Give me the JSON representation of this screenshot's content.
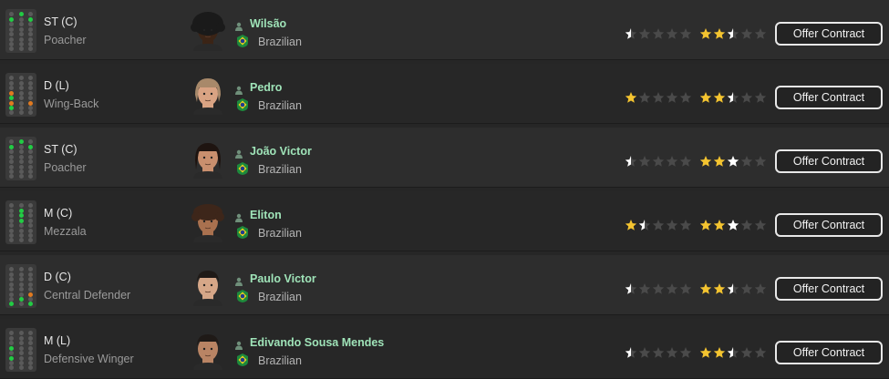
{
  "colors": {
    "name_text": "#9fe3b8",
    "star_gold": "#f4c430",
    "star_white": "#ffffff",
    "star_empty": "#4a4a4a",
    "dot_green": "#22cc44",
    "dot_orange": "#e07a20",
    "dot_yellow": "#d7c83a"
  },
  "players": [
    {
      "position": "ST (C)",
      "role": "Poacher",
      "name": "Wilsão",
      "nationality": "Brazilian",
      "action_label": "Offer Contract",
      "current_ability_stars": 0.5,
      "potential_ability_stars": 2.5,
      "potential_extra": "gold",
      "pitch_marks": [
        [
          "green",
          "top-center"
        ],
        [
          "green",
          "top-left"
        ],
        [
          "green",
          "top-right"
        ]
      ],
      "hair": "afro",
      "skin": "#3b2416"
    },
    {
      "position": "D (L)",
      "role": "Wing-Back",
      "name": "Pedro",
      "nationality": "Brazilian",
      "action_label": "Offer Contract",
      "current_ability_stars": 1,
      "potential_ability_stars": 2.5,
      "potential_extra": "gold",
      "pitch_marks": [
        [
          "orange",
          "left-mid"
        ],
        [
          "green",
          "left-low"
        ],
        [
          "orange",
          "left-mid2"
        ],
        [
          "orange",
          "right-low"
        ],
        [
          "green",
          "left-back"
        ]
      ],
      "hair": "long-light",
      "skin": "#d9a383"
    },
    {
      "position": "ST (C)",
      "role": "Poacher",
      "name": "João Victor",
      "nationality": "Brazilian",
      "action_label": "Offer Contract",
      "current_ability_stars": 0.5,
      "potential_ability_stars": 3,
      "potential_extra": "white",
      "pitch_marks": [
        [
          "green",
          "top-center"
        ],
        [
          "green",
          "top-left"
        ],
        [
          "green",
          "top-right"
        ]
      ],
      "hair": "long-dark",
      "skin": "#c98f6e"
    },
    {
      "position": "M (C)",
      "role": "Mezzala",
      "name": "Eliton",
      "nationality": "Brazilian",
      "action_label": "Offer Contract",
      "current_ability_stars": 1.5,
      "potential_ability_stars": 3,
      "potential_extra": "white",
      "pitch_marks": [
        [
          "green",
          "mid-center"
        ],
        [
          "green",
          "mid-center2"
        ],
        [
          "green",
          "mid-center3"
        ]
      ],
      "hair": "curly",
      "skin": "#a9714f"
    },
    {
      "position": "D (C)",
      "role": "Central Defender",
      "name": "Paulo Victor",
      "nationality": "Brazilian",
      "action_label": "Offer Contract",
      "current_ability_stars": 0.5,
      "potential_ability_stars": 2.5,
      "potential_extra": "gold",
      "pitch_marks": [
        [
          "orange",
          "right-low"
        ],
        [
          "green",
          "back-center"
        ],
        [
          "green",
          "back-left"
        ],
        [
          "green",
          "back-right"
        ]
      ],
      "hair": "short-dark",
      "skin": "#d6a788"
    },
    {
      "position": "M (L)",
      "role": "Defensive Winger",
      "name": "Edivando Sousa Mendes",
      "nationality": "Brazilian",
      "action_label": "Offer Contract",
      "current_ability_stars": 0.5,
      "potential_ability_stars": 2.5,
      "potential_extra": "gold",
      "pitch_marks": [
        [
          "yellow",
          "left-top"
        ],
        [
          "green",
          "left-mid"
        ],
        [
          "green",
          "left-mid2"
        ]
      ],
      "hair": "short-dark",
      "skin": "#b98464"
    }
  ]
}
